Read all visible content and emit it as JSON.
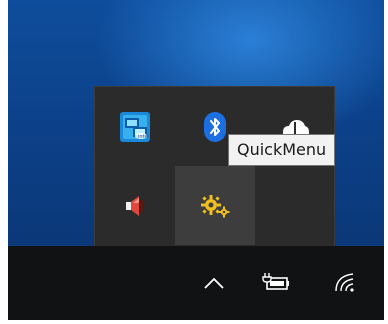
{
  "tooltip": {
    "text": "QuickMenu"
  },
  "tray": {
    "icons": [
      {
        "name": "intel-graphics-icon",
        "color": "#0a7fd0"
      },
      {
        "name": "bluetooth-icon",
        "color": "#1b6fe0"
      },
      {
        "name": "onedrive-icon",
        "color": "#ffffff"
      },
      {
        "name": "speaker-muted-icon",
        "color": "#e0483c"
      },
      {
        "name": "quickmenu-gear-icon",
        "color": "#f0c020"
      }
    ]
  },
  "taskbar": {
    "icons": [
      "chevron-up-icon",
      "power-plug-battery-icon",
      "wifi-icon"
    ]
  }
}
